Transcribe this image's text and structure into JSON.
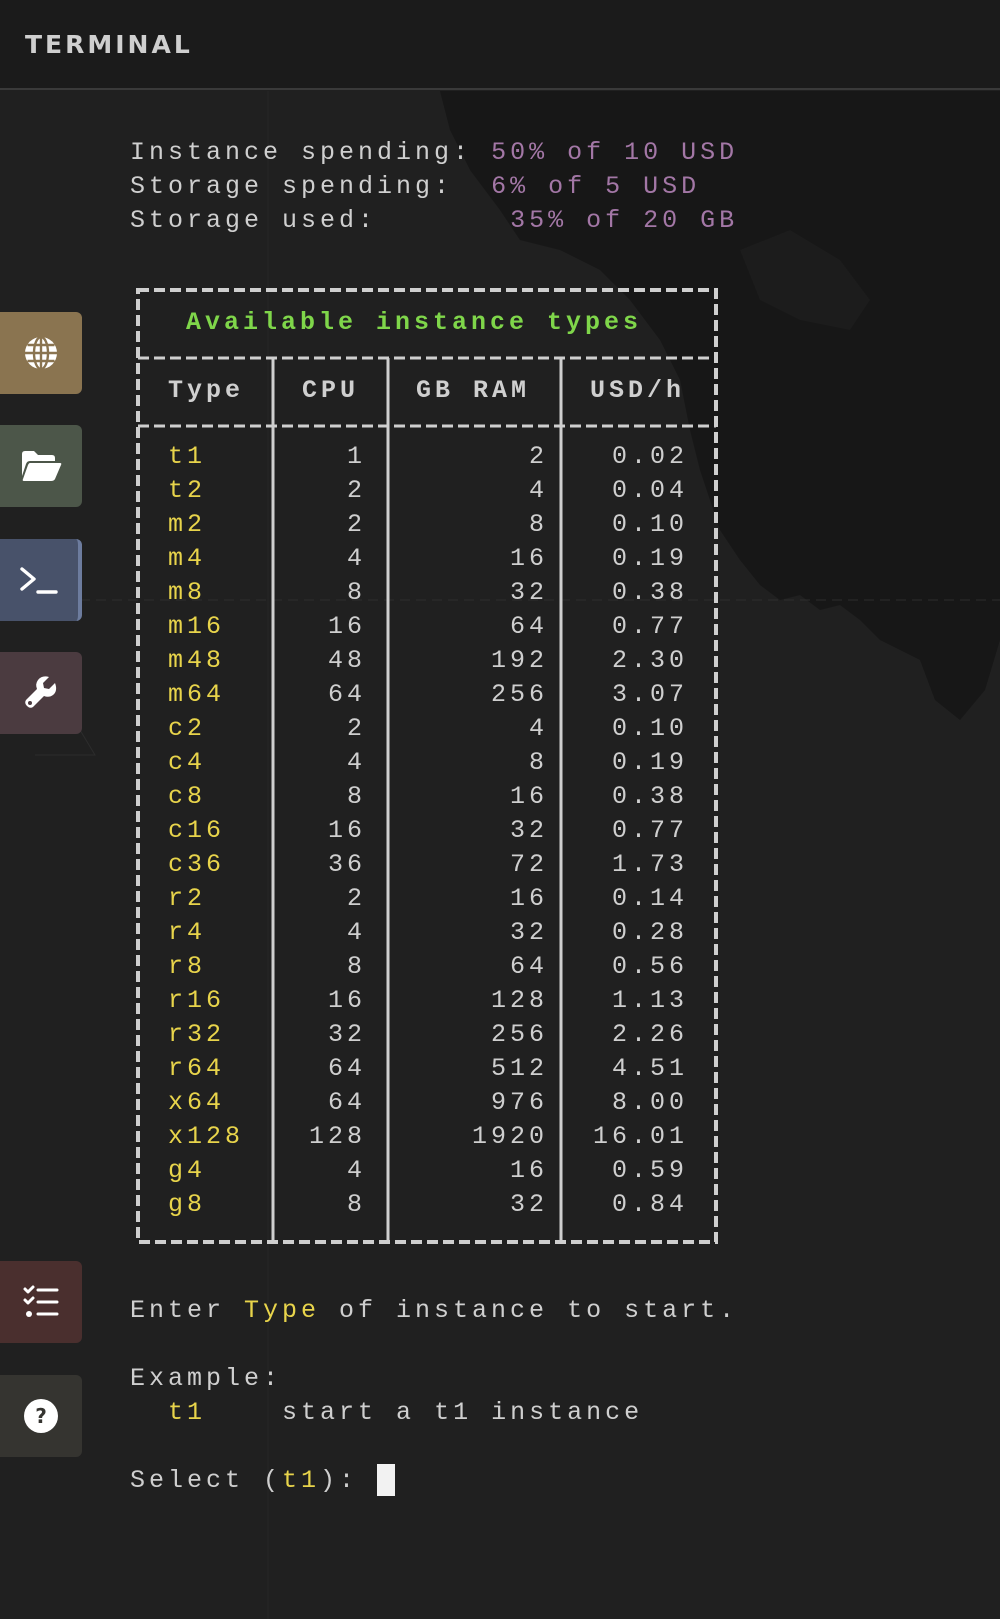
{
  "header": {
    "title": "TERMINAL"
  },
  "sidebar": {
    "items": [
      {
        "name": "globe",
        "color": "#8a7450"
      },
      {
        "name": "folder",
        "color": "#4c5649"
      },
      {
        "name": "terminal",
        "color": "#48526a",
        "active": true
      },
      {
        "name": "wrench",
        "color": "#4b3b40"
      },
      {
        "name": "checklist",
        "color": "#4a2f2e"
      },
      {
        "name": "help",
        "color": "#353430"
      }
    ]
  },
  "terminal": {
    "spending": [
      {
        "label": "Instance spending:",
        "value": "50% of 10 USD"
      },
      {
        "label": "Storage spending:",
        "value": "6% of 5 USD"
      },
      {
        "label": "Storage used:",
        "value": "35% of 20 GB"
      }
    ],
    "table": {
      "title": "Available instance types",
      "headers": [
        "Type",
        "CPU",
        "GB RAM",
        "USD/h"
      ],
      "rows": [
        [
          "t1",
          "1",
          "2",
          "0.02"
        ],
        [
          "t2",
          "2",
          "4",
          "0.04"
        ],
        [
          "m2",
          "2",
          "8",
          "0.10"
        ],
        [
          "m4",
          "4",
          "16",
          "0.19"
        ],
        [
          "m8",
          "8",
          "32",
          "0.38"
        ],
        [
          "m16",
          "16",
          "64",
          "0.77"
        ],
        [
          "m48",
          "48",
          "192",
          "2.30"
        ],
        [
          "m64",
          "64",
          "256",
          "3.07"
        ],
        [
          "c2",
          "2",
          "4",
          "0.10"
        ],
        [
          "c4",
          "4",
          "8",
          "0.19"
        ],
        [
          "c8",
          "8",
          "16",
          "0.38"
        ],
        [
          "c16",
          "16",
          "32",
          "0.77"
        ],
        [
          "c36",
          "36",
          "72",
          "1.73"
        ],
        [
          "r2",
          "2",
          "16",
          "0.14"
        ],
        [
          "r4",
          "4",
          "32",
          "0.28"
        ],
        [
          "r8",
          "8",
          "64",
          "0.56"
        ],
        [
          "r16",
          "16",
          "128",
          "1.13"
        ],
        [
          "r32",
          "32",
          "256",
          "2.26"
        ],
        [
          "r64",
          "64",
          "512",
          "4.51"
        ],
        [
          "x64",
          "64",
          "976",
          "8.00"
        ],
        [
          "x128",
          "128",
          "1920",
          "16.01"
        ],
        [
          "g4",
          "4",
          "16",
          "0.59"
        ],
        [
          "g8",
          "8",
          "32",
          "0.84"
        ]
      ]
    },
    "instructions": {
      "prefix": "Enter ",
      "keyword": "Type",
      "suffix": " of instance to start."
    },
    "example": {
      "label": "Example:",
      "command": "t1",
      "description": "start a t1 instance"
    },
    "prompt": {
      "prefix": "Select (",
      "default": "t1",
      "suffix": "): "
    }
  }
}
